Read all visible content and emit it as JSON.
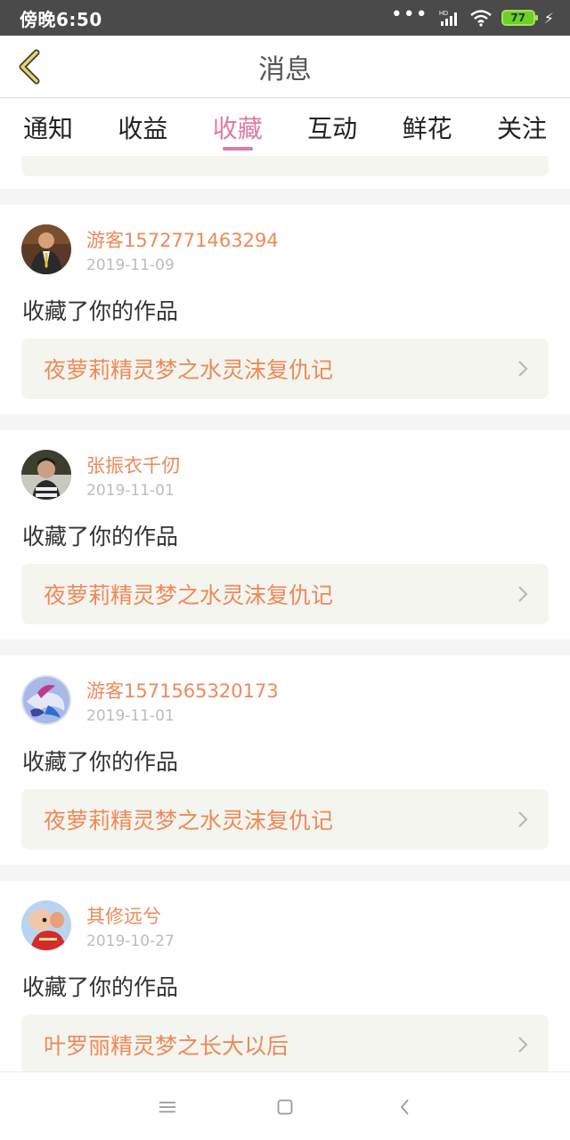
{
  "status_bar": {
    "time": "傍晚6:50",
    "network": "HD",
    "battery": "77"
  },
  "header": {
    "title": "消息"
  },
  "tabs": [
    {
      "label": "通知",
      "active": false
    },
    {
      "label": "收益",
      "active": false
    },
    {
      "label": "收藏",
      "active": true
    },
    {
      "label": "互动",
      "active": false
    },
    {
      "label": "鲜花",
      "active": false
    },
    {
      "label": "关注",
      "active": false
    }
  ],
  "messages": [
    {
      "name": "游客1572771463294",
      "date": "2019-11-09",
      "action": "收藏了你的作品",
      "work_title": "夜萝莉精灵梦之水灵沫复仇记"
    },
    {
      "name": "张振衣千仞",
      "date": "2019-11-01",
      "action": "收藏了你的作品",
      "work_title": "夜萝莉精灵梦之水灵沫复仇记"
    },
    {
      "name": "游客1571565320173",
      "date": "2019-11-01",
      "action": "收藏了你的作品",
      "work_title": "夜萝莉精灵梦之水灵沫复仇记"
    },
    {
      "name": "其修远兮",
      "date": "2019-10-27",
      "action": "收藏了你的作品",
      "work_title": "叶罗丽精灵梦之长大以后"
    }
  ],
  "colors": {
    "accent": "#e07aa6",
    "name": "#ec8a5a",
    "card_box": "#f5f5ef"
  }
}
